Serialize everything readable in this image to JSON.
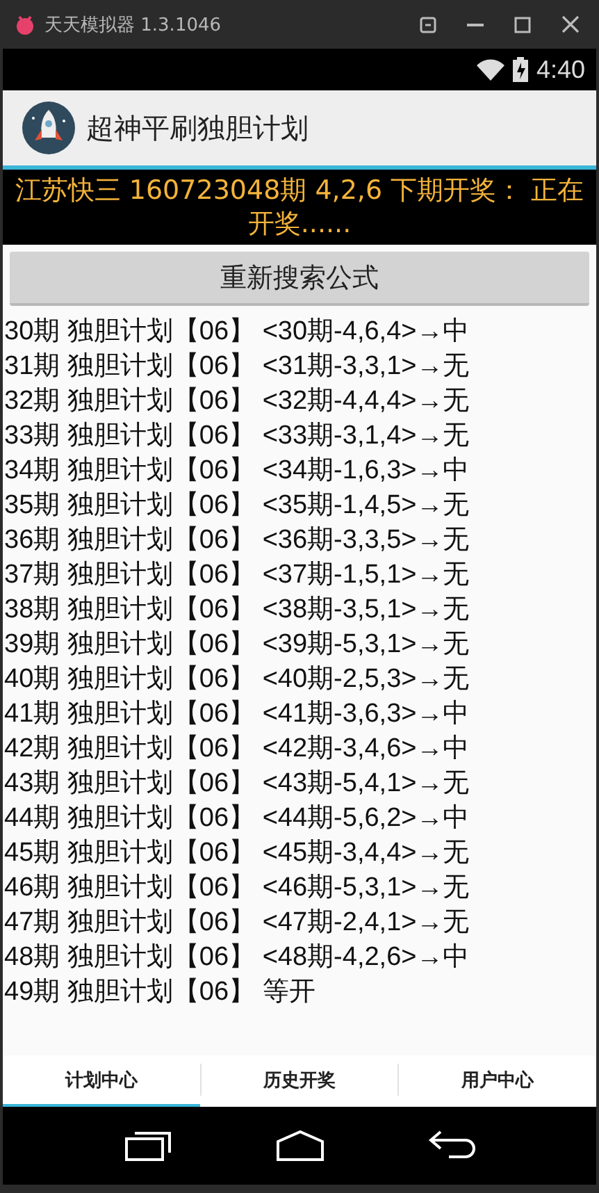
{
  "window": {
    "title": "天天模拟器 1.3.1046"
  },
  "status_bar": {
    "time": "4:40"
  },
  "app_bar": {
    "title": "超神平刷独胆计划"
  },
  "notice": "江苏快三 160723048期 4,2,6 下期开奖： 正在开奖......",
  "search_button": "重新搜索公式",
  "rows": [
    "30期 独胆计划【06】 <30期-4,6,4>→中",
    "31期 独胆计划【06】 <31期-3,3,1>→无",
    "32期 独胆计划【06】 <32期-4,4,4>→无",
    "33期 独胆计划【06】 <33期-3,1,4>→无",
    "34期 独胆计划【06】 <34期-1,6,3>→中",
    "35期 独胆计划【06】 <35期-1,4,5>→无",
    "36期 独胆计划【06】 <36期-3,3,5>→无",
    "37期 独胆计划【06】 <37期-1,5,1>→无",
    "38期 独胆计划【06】 <38期-3,5,1>→无",
    "39期 独胆计划【06】 <39期-5,3,1>→无",
    "40期 独胆计划【06】 <40期-2,5,3>→无",
    "41期 独胆计划【06】 <41期-3,6,3>→中",
    "42期 独胆计划【06】 <42期-3,4,6>→中",
    "43期 独胆计划【06】 <43期-5,4,1>→无",
    "44期 独胆计划【06】 <44期-5,6,2>→中",
    "45期 独胆计划【06】 <45期-3,4,4>→无",
    "46期 独胆计划【06】 <46期-5,3,1>→无",
    "47期 独胆计划【06】 <47期-2,4,1>→无",
    "48期 独胆计划【06】 <48期-4,2,6>→中",
    "49期 独胆计划【06】 等开"
  ],
  "tabs": [
    {
      "label": "计划中心",
      "selected": true
    },
    {
      "label": "历史开奖",
      "selected": false
    },
    {
      "label": "用户中心",
      "selected": false
    }
  ]
}
